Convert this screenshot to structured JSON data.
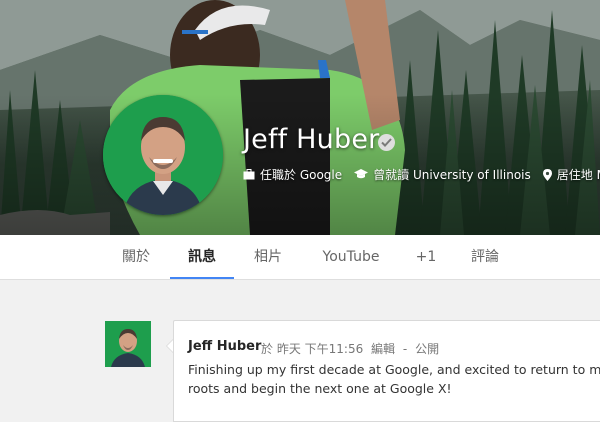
{
  "profile": {
    "name": "Jeff Huber",
    "info": [
      {
        "icon": "briefcase-icon",
        "text": "任職於 Google"
      },
      {
        "icon": "graduation-cap-icon",
        "text": "曾就讀 University of Illinois"
      },
      {
        "icon": "location-pin-icon",
        "text": "居住地 Men"
      }
    ]
  },
  "tabs": [
    {
      "label": "關於",
      "active": false
    },
    {
      "label": "訊息",
      "active": true
    },
    {
      "label": "相片",
      "active": false
    },
    {
      "label": "YouTube",
      "active": false
    },
    {
      "label": "+1",
      "active": false
    },
    {
      "label": "評論",
      "active": false
    }
  ],
  "post": {
    "author": "Jeff Huber",
    "time": "於 昨天 下午11:56",
    "edited": "編輯",
    "separator": "-",
    "visibility": "公開",
    "text_lines": [
      "Finishing up my first decade at Google, and excited to return to my star",
      "roots and begin the next one at Google X!"
    ]
  },
  "colors": {
    "accent": "#4285f4",
    "avatar_green": "#1e9e4d"
  }
}
